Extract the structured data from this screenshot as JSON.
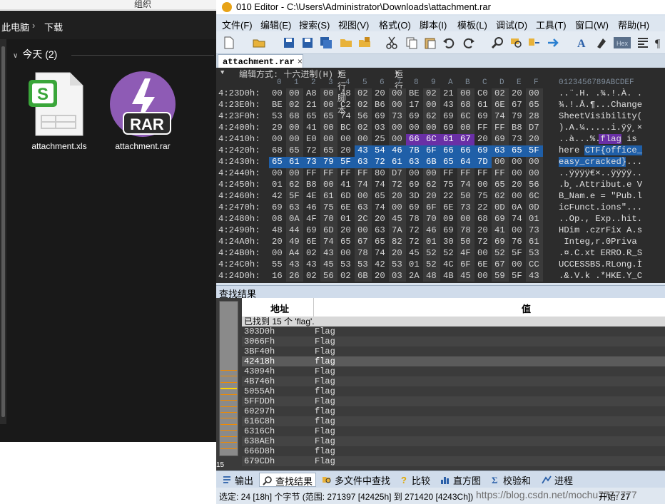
{
  "explorer": {
    "ribbon_label": "组织",
    "breadcrumb": [
      "此电脑",
      "下载"
    ],
    "group_header": "今天 (2)",
    "files": [
      {
        "name": "attachment.xls",
        "icon": "spreadsheet-file-icon"
      },
      {
        "name": "attachment.rar",
        "icon": "rar-archive-icon"
      }
    ]
  },
  "editor": {
    "title": "010 Editor - C:\\Users\\Administrator\\Downloads\\attachment.rar",
    "menu": [
      "文件(F)",
      "编辑(E)",
      "搜索(S)",
      "视图(V)",
      "格式(O)",
      "脚本(I)",
      "模板(L)",
      "调试(D)",
      "工具(T)",
      "窗口(W)",
      "帮助(H)"
    ],
    "tab_label": "attachment.rar",
    "tab_close": "×",
    "hex_options": {
      "edit_mode": "编辑方式: 十六进制(H)",
      "run_script": "运行脚本",
      "run_template": "运行模板"
    },
    "column_header_hex": [
      "0",
      "1",
      "2",
      "3",
      "4",
      "5",
      "6",
      "7",
      "8",
      "9",
      "A",
      "B",
      "C",
      "D",
      "E",
      "F"
    ],
    "column_header_ascii": "0123456789ABCDEF",
    "hex_rows": [
      {
        "addr": "4:23D0h:",
        "bytes": [
          "00",
          "00",
          "A8",
          "00",
          "48",
          "02",
          "20",
          "00",
          "BE",
          "02",
          "21",
          "00",
          "C0",
          "02",
          "20",
          "00"
        ],
        "ascii": "..¨.H. .¾.!.À. ."
      },
      {
        "addr": "4:23E0h:",
        "bytes": [
          "BE",
          "02",
          "21",
          "00",
          "C2",
          "02",
          "B6",
          "00",
          "17",
          "00",
          "43",
          "68",
          "61",
          "6E",
          "67",
          "65"
        ],
        "ascii": "¾.!.Â.¶...Change"
      },
      {
        "addr": "4:23F0h:",
        "bytes": [
          "53",
          "68",
          "65",
          "65",
          "74",
          "56",
          "69",
          "73",
          "69",
          "62",
          "69",
          "6C",
          "69",
          "74",
          "79",
          "28"
        ],
        "ascii": "SheetVisibility("
      },
      {
        "addr": "4:2400h:",
        "bytes": [
          "29",
          "00",
          "41",
          "00",
          "BC",
          "02",
          "03",
          "00",
          "00",
          "00",
          "69",
          "00",
          "FF",
          "FF",
          "B8",
          "D7"
        ],
        "ascii": ").A.¼.....i.ÿÿ¸×"
      },
      {
        "addr": "4:2410h:",
        "bytes": [
          "00",
          "00",
          "E0",
          "00",
          "00",
          "00",
          "25",
          "00",
          "66",
          "6C",
          "61",
          "67",
          "20",
          "69",
          "73",
          "20"
        ],
        "ascii": "..à...%.flag is "
      },
      {
        "addr": "4:2420h:",
        "bytes": [
          "68",
          "65",
          "72",
          "65",
          "20",
          "43",
          "54",
          "46",
          "7B",
          "6F",
          "66",
          "66",
          "69",
          "63",
          "65",
          "5F"
        ],
        "ascii": "here CTF{office_"
      },
      {
        "addr": "4:2430h:",
        "bytes": [
          "65",
          "61",
          "73",
          "79",
          "5F",
          "63",
          "72",
          "61",
          "63",
          "6B",
          "65",
          "64",
          "7D",
          "00",
          "00",
          "00"
        ],
        "ascii": "easy_cracked}..."
      },
      {
        "addr": "4:2440h:",
        "bytes": [
          "00",
          "00",
          "FF",
          "FF",
          "FF",
          "FF",
          "80",
          "D7",
          "00",
          "00",
          "FF",
          "FF",
          "FF",
          "FF",
          "00",
          "00"
        ],
        "ascii": "..ÿÿÿÿ€×..ÿÿÿÿ.."
      },
      {
        "addr": "4:2450h:",
        "bytes": [
          "01",
          "62",
          "B8",
          "00",
          "41",
          "74",
          "74",
          "72",
          "69",
          "62",
          "75",
          "74",
          "00",
          "65",
          "20",
          "56"
        ],
        "ascii": ".b¸.Attribut.e V"
      },
      {
        "addr": "4:2460h:",
        "bytes": [
          "42",
          "5F",
          "4E",
          "61",
          "6D",
          "00",
          "65",
          "20",
          "3D",
          "20",
          "22",
          "50",
          "75",
          "62",
          "00",
          "6C"
        ],
        "ascii": "B_Nam.e = \"Pub.l"
      },
      {
        "addr": "4:2470h:",
        "bytes": [
          "69",
          "63",
          "46",
          "75",
          "6E",
          "63",
          "74",
          "00",
          "69",
          "6F",
          "6E",
          "73",
          "22",
          "0D",
          "0A",
          "0D"
        ],
        "ascii": "icFunct.ions\"..."
      },
      {
        "addr": "4:2480h:",
        "bytes": [
          "08",
          "0A",
          "4F",
          "70",
          "01",
          "2C",
          "20",
          "45",
          "78",
          "70",
          "09",
          "00",
          "68",
          "69",
          "74",
          "01"
        ],
        "ascii": "..Op., Exp..hit."
      },
      {
        "addr": "4:2490h:",
        "bytes": [
          "48",
          "44",
          "69",
          "6D",
          "20",
          "00",
          "63",
          "7A",
          "72",
          "46",
          "69",
          "78",
          "20",
          "41",
          "00",
          "73"
        ],
        "ascii": "HDim .czrFix A.s"
      },
      {
        "addr": "4:24A0h:",
        "bytes": [
          "20",
          "49",
          "6E",
          "74",
          "65",
          "67",
          "65",
          "82",
          "72",
          "01",
          "30",
          "50",
          "72",
          "69",
          "76",
          "61"
        ],
        "ascii": " Integ‚r.0Priva"
      },
      {
        "addr": "4:24B0h:",
        "bytes": [
          "00",
          "A4",
          "02",
          "43",
          "00",
          "78",
          "74",
          "20",
          "45",
          "52",
          "52",
          "4F",
          "00",
          "52",
          "5F",
          "53"
        ],
        "ascii": ".¤.C.xt ERRO.R_S"
      },
      {
        "addr": "4:24C0h:",
        "bytes": [
          "55",
          "43",
          "43",
          "45",
          "53",
          "53",
          "42",
          "53",
          "01",
          "52",
          "4C",
          "6F",
          "6E",
          "67",
          "00",
          "CC"
        ],
        "ascii": "UCCESSBS.RLong.Ì"
      },
      {
        "addr": "4:24D0h:",
        "bytes": [
          "16",
          "26",
          "02",
          "56",
          "02",
          "6B",
          "20",
          "03",
          "2A",
          "48",
          "4B",
          "45",
          "00",
          "59",
          "5F",
          "43"
        ],
        "ascii": ".&.V.k .*HKE.Y_C"
      }
    ],
    "find_results": {
      "panel_title": "查找结果",
      "col_address": "地址",
      "col_value": "值",
      "summary": "已找到 15 个 'flag'.",
      "minimap_label": "15",
      "rows": [
        {
          "addr": "303D0h",
          "value": "Flag"
        },
        {
          "addr": "3066Fh",
          "value": "Flag"
        },
        {
          "addr": "3BF40h",
          "value": "Flag"
        },
        {
          "addr": "42418h",
          "value": "flag"
        },
        {
          "addr": "43094h",
          "value": "Flag"
        },
        {
          "addr": "4B746h",
          "value": "Flag"
        },
        {
          "addr": "5055Ah",
          "value": "flag"
        },
        {
          "addr": "5FFDDh",
          "value": "Flag"
        },
        {
          "addr": "60297h",
          "value": "flag"
        },
        {
          "addr": "616C8h",
          "value": "flag"
        },
        {
          "addr": "6316Ch",
          "value": "Flag"
        },
        {
          "addr": "638AEh",
          "value": "Flag"
        },
        {
          "addr": "666D8h",
          "value": "flag"
        },
        {
          "addr": "679CDh",
          "value": "Flag"
        }
      ]
    },
    "bottom_tabs": [
      "输出",
      "查找结果",
      "多文件中查找",
      "比较",
      "直方图",
      "校验和",
      "进程"
    ],
    "status": "选定: 24 [18h] 个字节 (范围: 271397 [42425h] 到 271420 [4243Ch])",
    "status_extra": "开始: 27",
    "watermark": "https://blog.csdn.net/mochu7777777",
    "colors": {
      "selection_purple": "#6a2fa6",
      "selection_blue": "#1f5fa8",
      "hex_bg": "#2c2c2c",
      "minimap_marker": "#f08a00"
    }
  }
}
